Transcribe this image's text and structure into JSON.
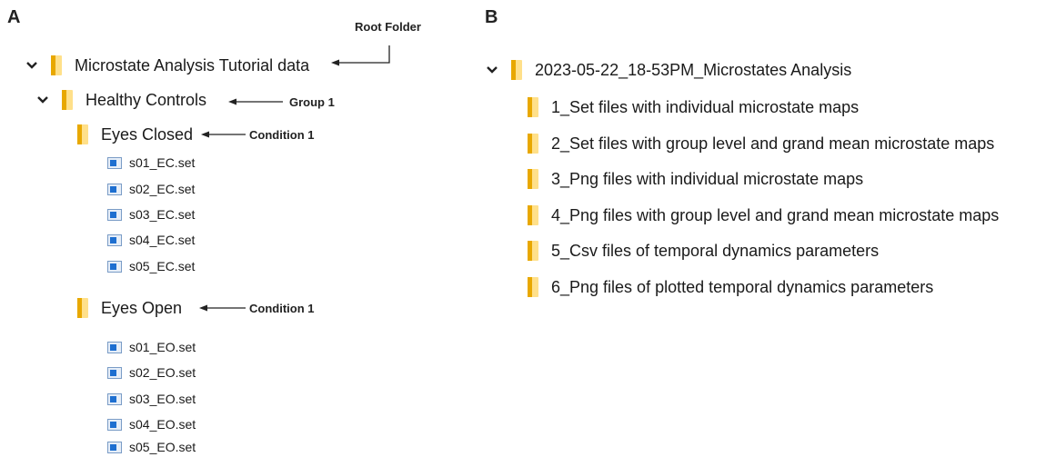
{
  "panels": {
    "a_label": "A",
    "b_label": "B"
  },
  "annotations": {
    "root_folder": "Root Folder",
    "group_1": "Group 1",
    "condition_1_closed": "Condition 1",
    "condition_1_open": "Condition 1"
  },
  "tree_a": {
    "root": "Microstate Analysis Tutorial data",
    "group": "Healthy Controls",
    "eyes_closed": {
      "label": "Eyes Closed",
      "files": [
        "s01_EC.set",
        "s02_EC.set",
        "s03_EC.set",
        "s04_EC.set",
        "s05_EC.set"
      ]
    },
    "eyes_open": {
      "label": "Eyes Open",
      "files": [
        "s01_EO.set",
        "s02_EO.set",
        "s03_EO.set",
        "s04_EO.set",
        "s05_EO.set"
      ]
    }
  },
  "tree_b": {
    "root": "2023-05-22_18-53PM_Microstates Analysis",
    "folders": [
      "1_Set files with individual microstate maps",
      "2_Set files with group level and grand mean microstate maps",
      "3_Png files with individual microstate maps",
      "4_Png files with group level and grand mean microstate maps",
      "5_Csv files of temporal dynamics parameters",
      "6_Png files of plotted temporal dynamics parameters"
    ]
  },
  "icons": {
    "chevron": "chevron-down-icon",
    "folder": "folder-icon",
    "file": "set-file-icon"
  },
  "colors": {
    "folder_light": "#FFE08A",
    "folder_dark": "#E8A800",
    "file_blue": "#1E6FD0",
    "file_frame": "#7A9CC6"
  }
}
